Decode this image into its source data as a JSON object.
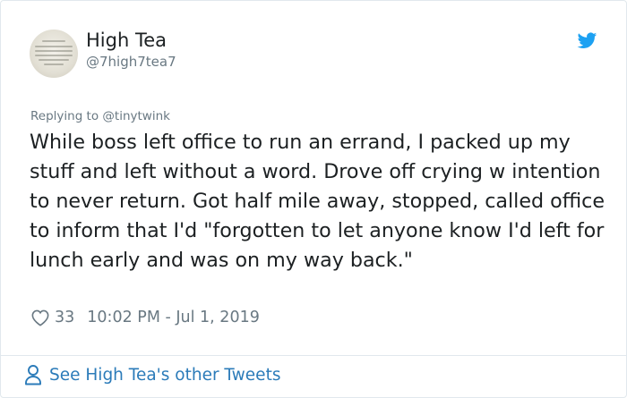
{
  "author": {
    "name": "High Tea",
    "handle": "@7high7tea7",
    "avatar_icon": "avatar-image"
  },
  "reply": {
    "prefix": "Replying to",
    "to_handle": "@tinytwink"
  },
  "tweet": {
    "text": "While boss left office to run an errand, I packed up my stuff and left without a word. Drove off crying w intention to never return. Got half mile away, stopped, called office to inform that I'd \"forgotten to let anyone know I'd left for lunch early and was on my way back.\"",
    "likes": "33",
    "timestamp": "10:02 PM - Jul 1, 2019"
  },
  "footer": {
    "link_text": "See High Tea's other Tweets"
  },
  "colors": {
    "twitter_blue": "#1da1f2",
    "link_blue": "#2b7bb9",
    "muted_gray": "#697882",
    "text_dark": "#1c2022",
    "border": "#e1e8ed"
  },
  "icons": {
    "brand": "twitter-bird-icon",
    "like": "heart-icon",
    "profile": "person-icon"
  }
}
